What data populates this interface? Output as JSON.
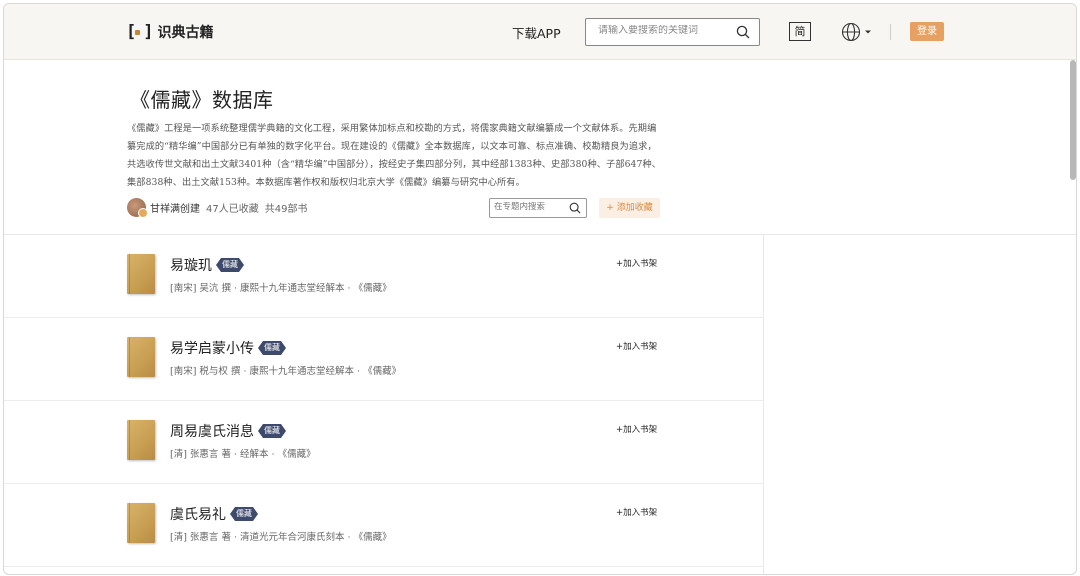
{
  "header": {
    "logo_text": "识典古籍",
    "download_app": "下载APP",
    "search_placeholder": "请输入要搜索的关键词",
    "lang_toggle": "简",
    "login": "登录"
  },
  "collection": {
    "title": "《儒藏》数据库",
    "description": "《儒藏》工程是一项系统整理儒学典籍的文化工程，采用繁体加标点和校勘的方式，将儒家典籍文献编纂成一个文献体系。先期编纂完成的“精华编”中国部分已有单独的数字化平台。现在建设的《儒藏》全本数据库，以文本可靠、标点准确、校勘精良为追求，共选收传世文献和出土文献3401种（含“精华编”中国部分），按经史子集四部分列，其中经部1383种、史部380种、子部647种、集部838种、出土文献153种。本数据库著作权和版权归北京大学《儒藏》编纂与研究中心所有。",
    "creator": "甘祥满创建",
    "favorites": "47人已收藏",
    "book_count": "共49部书",
    "topic_search_placeholder": "在专题内搜索",
    "add_favorite": "+ 添加收藏"
  },
  "books": [
    {
      "title": "易璇玑",
      "tag": "儒藏",
      "meta": "[南宋] 吴沆 撰 · 康熙十九年通志堂经解本 · 《儒藏》",
      "action": "+加入书架"
    },
    {
      "title": "易学启蒙小传",
      "tag": "儒藏",
      "meta": "[南宋] 税与权 撰 · 康熙十九年通志堂经解本 · 《儒藏》",
      "action": "+加入书架"
    },
    {
      "title": "周易虞氏消息",
      "tag": "儒藏",
      "meta": "[清] 张惠言 著 · 经解本 · 《儒藏》",
      "action": "+加入书架"
    },
    {
      "title": "虞氏易礼",
      "tag": "儒藏",
      "meta": "[清] 张惠言 著 · 清道光元年合河康氏刻本 · 《儒藏》",
      "action": "+加入书架"
    }
  ],
  "icons": [
    "search-icon",
    "globe-icon",
    "chevron-down-icon"
  ]
}
